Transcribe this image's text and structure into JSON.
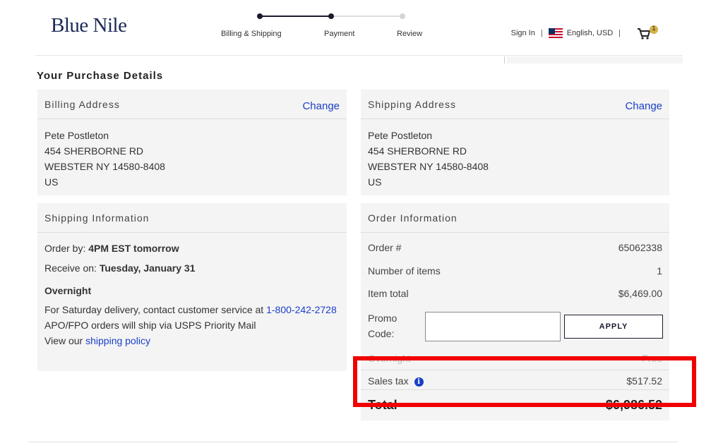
{
  "header": {
    "logo_text": "Blue Nile",
    "logo_mark": ".",
    "steps": [
      "Billing & Shipping",
      "Payment",
      "Review"
    ],
    "sign_in": "Sign In",
    "separator": "|",
    "language": "English, USD",
    "cart_count": "1"
  },
  "page_title": "Your Purchase Details",
  "billing": {
    "title": "Billing Address",
    "change": "Change",
    "name": "Pete Postleton",
    "street": "454 SHERBORNE RD",
    "city": "WEBSTER NY 14580-8408",
    "country": "US"
  },
  "shipping_address": {
    "title": "Shipping Address",
    "change": "Change",
    "name": "Pete Postleton",
    "street": "454 SHERBORNE RD",
    "city": "WEBSTER NY 14580-8408",
    "country": "US"
  },
  "shipping_info": {
    "title": "Shipping Information",
    "order_by_label": "Order by:",
    "order_by_value": "4PM EST tomorrow",
    "receive_label": "Receive on:",
    "receive_value": "Tuesday, January 31",
    "method": "Overnight",
    "saturday_text": "For Saturday delivery, contact customer service at ",
    "phone": "1-800-242-2728",
    "apo_text": "APO/FPO orders will ship via USPS Priority Mail",
    "policy_prefix": "View our ",
    "policy_link": "shipping policy"
  },
  "order_info": {
    "title": "Order Information",
    "order_number_label": "Order #",
    "order_number_value": "65062338",
    "items_label": "Number of items",
    "items_value": "1",
    "item_total_label": "Item total",
    "item_total_value": "$6,469.00",
    "promo_label_1": "Promo",
    "promo_label_2": "Code:",
    "promo_placeholder": "",
    "apply_label": "APPLY",
    "overnight_label": "Overnight",
    "overnight_value": "Free",
    "sales_tax_label": "Sales tax",
    "sales_tax_value": "$517.52",
    "total_label": "Total",
    "total_value": "$6,986.52"
  },
  "colors": {
    "brand_navy": "#1a2a56",
    "link_blue": "#1a3fc8",
    "highlight_red": "#f00000",
    "panel_bg": "#f4f4f4"
  }
}
